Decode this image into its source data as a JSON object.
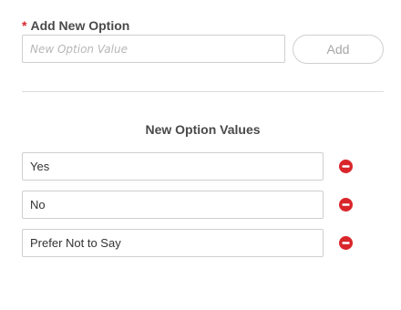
{
  "add_section": {
    "required_marker": "*",
    "label": "Add New Option",
    "input_placeholder": "New Option Value",
    "input_value": "",
    "add_button_label": "Add"
  },
  "options_section": {
    "heading": "New Option Values",
    "options": [
      {
        "value": "Yes"
      },
      {
        "value": "No"
      },
      {
        "value": "Prefer Not to Say"
      }
    ]
  },
  "colors": {
    "accent_red": "#d9262b",
    "border": "#cfcfcf",
    "divider": "#dddddd",
    "label_text": "#4a4a4a"
  },
  "icons": {
    "remove": "minus-circle-icon"
  }
}
